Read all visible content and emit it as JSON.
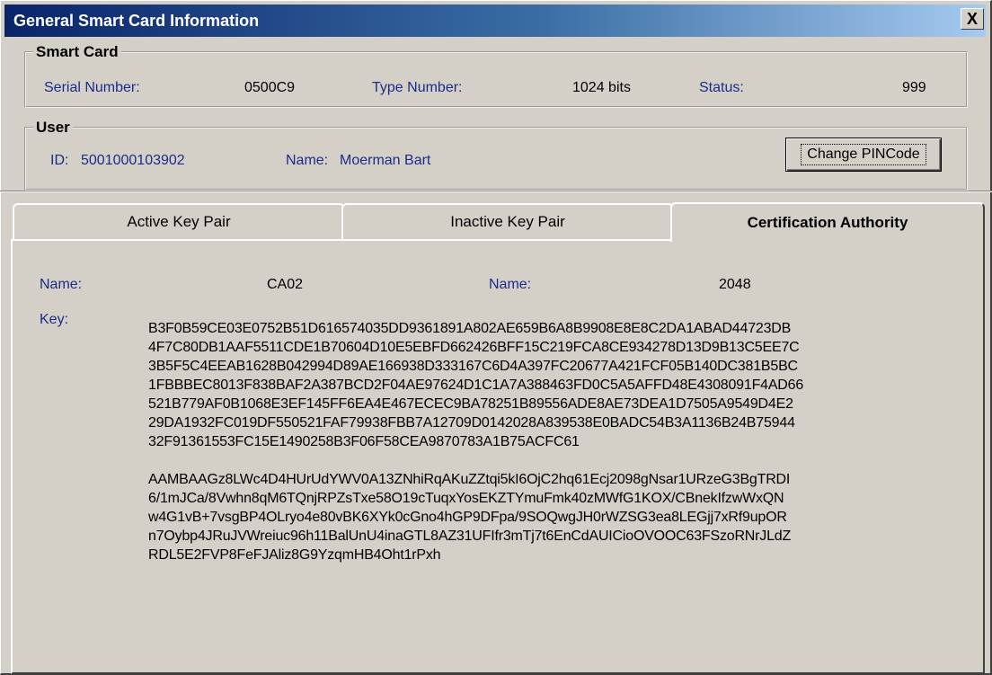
{
  "window": {
    "title": "General Smart Card Information",
    "close_label": "X"
  },
  "smart_card": {
    "legend": "Smart Card",
    "serial_label": "Serial Number:",
    "serial_value": "0500C9",
    "type_label": "Type Number:",
    "type_value": "1024 bits",
    "status_label": "Status:",
    "status_value": "999"
  },
  "user": {
    "legend": "User",
    "id_label": "ID:",
    "id_value": "5001000103902",
    "name_label": "Name:",
    "name_value": "Moerman Bart",
    "change_pin_label": "Change PINCode"
  },
  "tabs": [
    {
      "label": "Active Key Pair",
      "active": false
    },
    {
      "label": "Inactive Key Pair",
      "active": false
    },
    {
      "label": "Certification Authority",
      "active": true
    }
  ],
  "ca_panel": {
    "name_label": "Name:",
    "name_value": "CA02",
    "name2_label": "Name:",
    "name2_value": "2048",
    "key_label": "Key:",
    "key_hex_lines": [
      "B3F0B59CE03E0752B51D616574035DD9361891A802AE659B6A8B9908E8E8C2DA1ABAD44723DB",
      "4F7C80DB1AAF5511CDE1B70604D10E5EBFD662426BFF15C219FCA8CE934278D13D9B13C5EE7C",
      "3B5F5C4EEAB1628B042994D89AE166938D333167C6D4A397FC20677A421FCF05B140DC381B5BC",
      "1FBBBEC8013F838BAF2A387BCD2F04AE97624D1C1A7A388463FD0C5A5AFFD48E4308091F4AD66",
      "521B779AF0B1068E3EF145FF6EA4E467ECEC9BA78251B89556ADE8AE73DEA1D7505A9549D4E2",
      "29DA1932FC019DF550521FAF79938FBB7A12709D0142028A839538E0BADC54B3A1136B24B75944",
      "32F91361553FC15E1490258B3F06F58CEA9870783A1B75ACFC61"
    ],
    "key_b64_lines": [
      "AAMBAAGz8LWc4D4HUrUdYWV0A13ZNhiRqAKuZZtqi5kI6OjC2hq61Ecj2098gNsar1URzeG3BgTRDI",
      "6/1mJCa/8Vwhn8qM6TQnjRPZsTxe58O19cTuqxYosEKZTYmuFmk40zMWfG1KOX/CBnekIfzwWxQN",
      "w4G1vB+7vsgBP4OLryo4e80vBK6XYk0cGno4hGP9DFpa/9SOQwgJH0rWZSG3ea8LEGjj7xRf9upOR",
      "n7Oybp4JRuJVWreiuc96h11BalUnU4inaGTL8AZ31UFIfr3mTj7t6EnCdAUICioOVOOC63FSzoRNrJLdZ",
      "RDL5E2FVP8FeFJAliz8G9YzqmHB4Oht1rPxh"
    ]
  }
}
